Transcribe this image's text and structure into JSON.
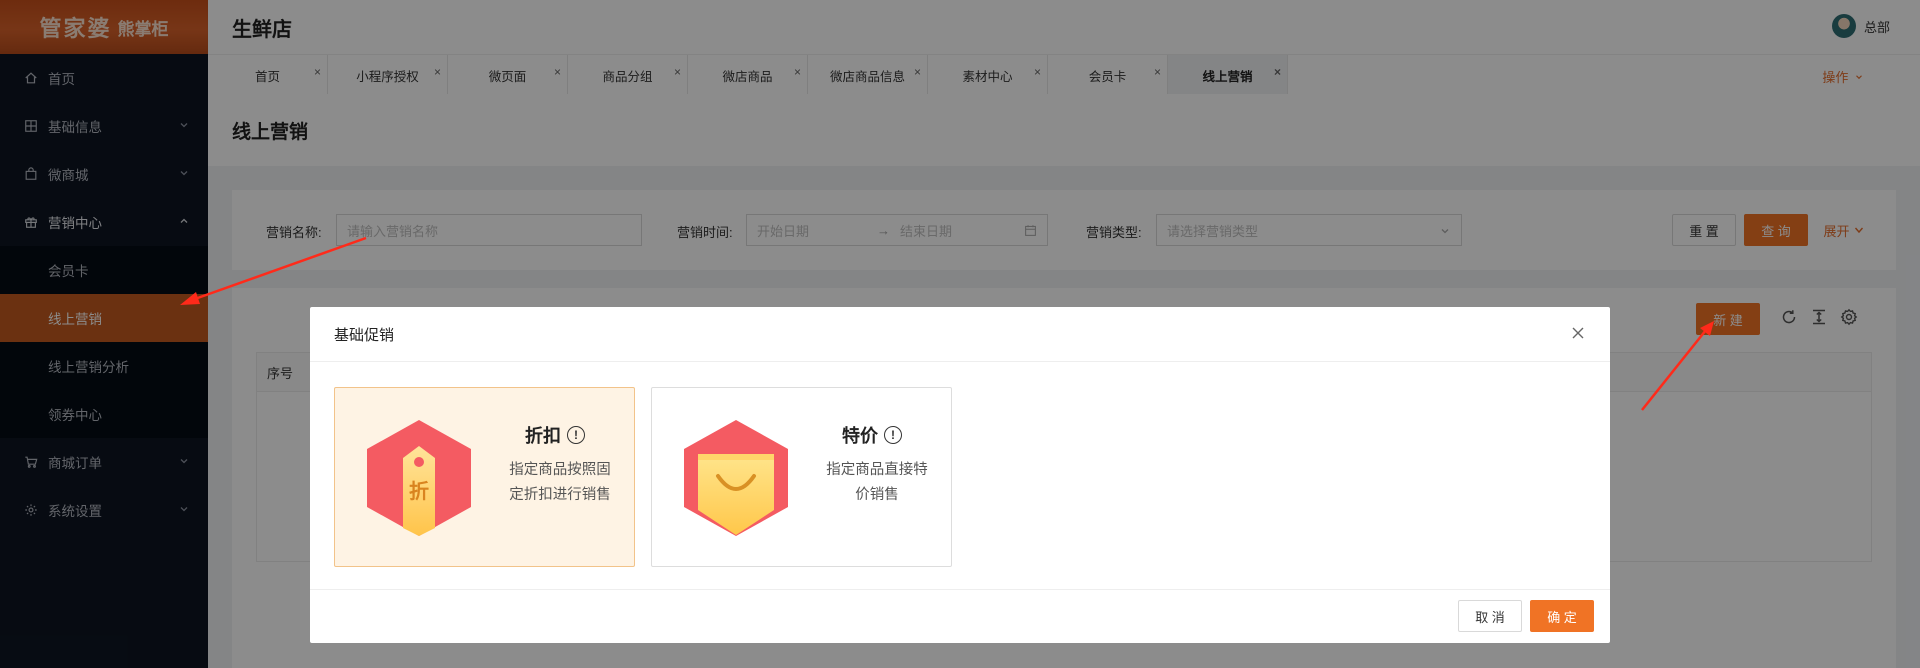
{
  "logo": {
    "main": "管家婆",
    "sub": "熊掌柜"
  },
  "sidebar": {
    "items": [
      {
        "label": "首页",
        "icon": "home-icon"
      },
      {
        "label": "基础信息",
        "icon": "grid-icon"
      },
      {
        "label": "微商城",
        "icon": "bag-icon"
      },
      {
        "label": "营销中心",
        "icon": "gift-icon"
      }
    ],
    "marketing_sub": [
      {
        "label": "会员卡"
      },
      {
        "label": "线上营销"
      },
      {
        "label": "线上营销分析"
      },
      {
        "label": "领券中心"
      }
    ],
    "bottom_items": [
      {
        "label": "商城订单",
        "icon": "cart-icon"
      },
      {
        "label": "系统设置",
        "icon": "gear-icon"
      }
    ]
  },
  "header": {
    "store": "生鲜店",
    "user": "总部"
  },
  "tabs": [
    {
      "label": "首页"
    },
    {
      "label": "小程序授权"
    },
    {
      "label": "微页面"
    },
    {
      "label": "商品分组"
    },
    {
      "label": "微店商品"
    },
    {
      "label": "微店商品信息"
    },
    {
      "label": "素材中心"
    },
    {
      "label": "会员卡"
    },
    {
      "label": "线上营销"
    }
  ],
  "tab_close": "×",
  "operations": "操作",
  "page_title": "线上营销",
  "search": {
    "name_label": "营销名称:",
    "name_placeholder": "请输入营销名称",
    "time_label": "营销时间:",
    "start_placeholder": "开始日期",
    "range_sep": "→",
    "end_placeholder": "结束日期",
    "type_label": "营销类型:",
    "type_placeholder": "请选择营销类型",
    "reset": "重 置",
    "query": "查 询",
    "expand": "展开"
  },
  "table": {
    "new": "新 建",
    "col_index": "序号"
  },
  "modal": {
    "title": "基础促销",
    "cards": [
      {
        "title": "折扣",
        "desc1": "指定商品按照固",
        "desc2": "定折扣进行销售",
        "badge": "折"
      },
      {
        "title": "特价",
        "desc1": "指定商品直接特",
        "desc2": "价销售"
      }
    ],
    "info_mark": "!",
    "cancel": "取 消",
    "ok": "确 定"
  },
  "colors": {
    "accent": "#f07325",
    "sidebar_bg": "#0d1522",
    "active_nav": "#c45a1f",
    "annotation_arrow": "#ff2a1a"
  }
}
